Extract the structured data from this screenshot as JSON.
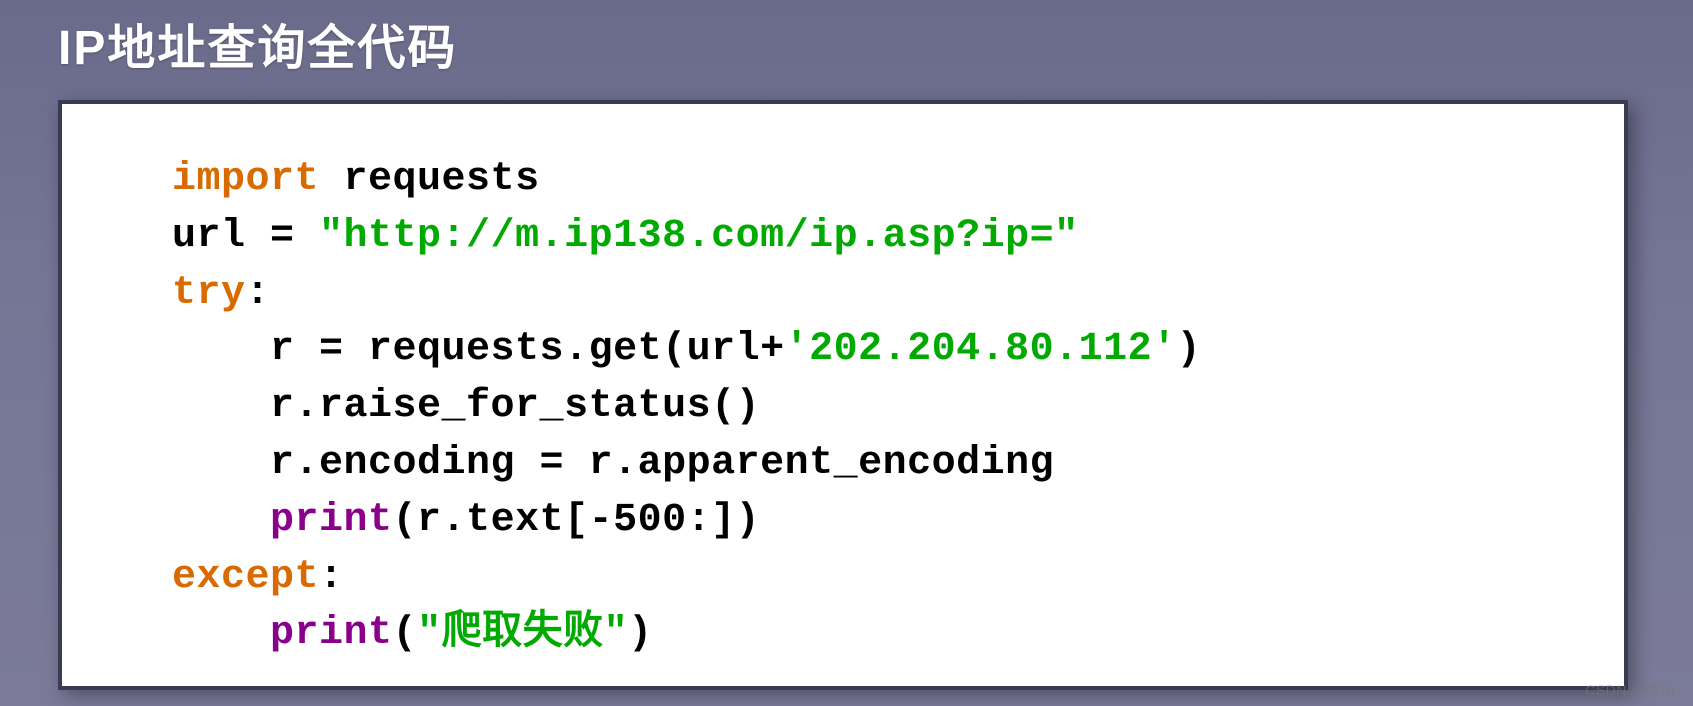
{
  "title": "IP地址查询全代码",
  "code": {
    "l1_kw": "import",
    "l1_rest": " requests",
    "l2_pre": "url = ",
    "l2_str": "\"http://m.ip138.com/ip.asp?ip=\"",
    "l3_kw": "try",
    "l3_rest": ":",
    "l4_pre": "r = requests.get(url+",
    "l4_str": "'202.204.80.112'",
    "l4_post": ")",
    "l5": "r.raise_for_status()",
    "l6": "r.encoding = r.apparent_encoding",
    "l7_kw": "print",
    "l7_rest": "(r.text[-500:])",
    "l8_kw": "except",
    "l8_rest": ":",
    "l9_kw": "print",
    "l9_pre": "(",
    "l9_str": "\"爬取失败\"",
    "l9_post": ")"
  },
  "watermark": "CSDN @嗯诺"
}
